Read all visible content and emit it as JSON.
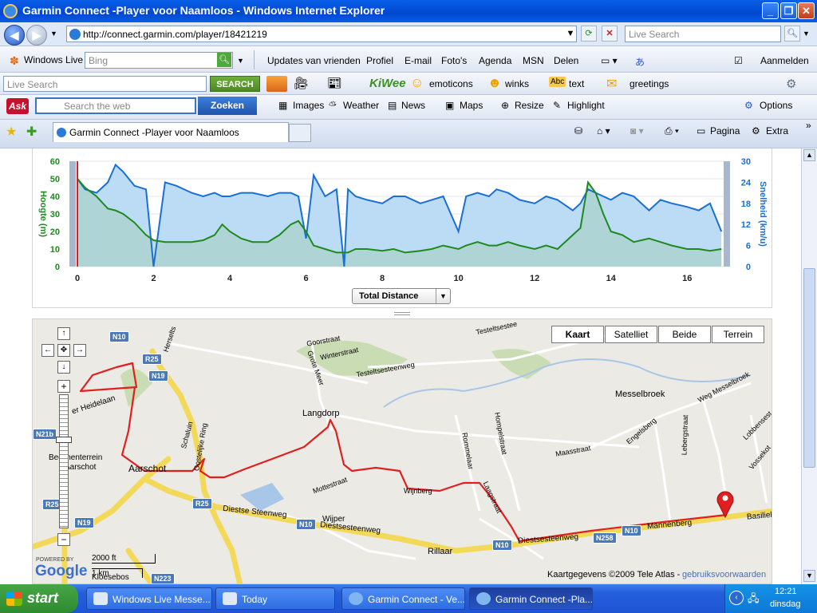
{
  "window": {
    "title": "Garmin Connect -Player voor Naamloos - Windows Internet Explorer"
  },
  "address": {
    "url": "http://connect.garmin.com/player/18421219",
    "search_placeholder": "Live Search"
  },
  "windows_live": {
    "label": "Windows Live",
    "bing_placeholder": "Bing",
    "links": [
      "Updates van vrienden",
      "Profiel",
      "E-mail",
      "Foto's",
      "Agenda",
      "MSN",
      "Delen"
    ],
    "signin": "Aanmelden"
  },
  "kiwee": {
    "search_placeholder": "Live Search",
    "search_button": "SEARCH",
    "brand": "KiWee",
    "items": [
      "emoticons",
      "winks",
      "text",
      "greetings"
    ]
  },
  "ask": {
    "logo": "Ask",
    "search_placeholder": "Search the web",
    "search_button": "Zoeken",
    "items": [
      "Images",
      "Weather",
      "News",
      "Maps",
      "Resize",
      "Highlight"
    ],
    "options": "Options"
  },
  "tabs": {
    "active": "Garmin Connect -Player voor Naamloos",
    "pagina": "Pagina",
    "extra": "Extra"
  },
  "chart": {
    "left_axis_label": "Hoogte (m)",
    "right_axis_label": "Snelheid (km/u)",
    "left_ticks": [
      "0",
      "10",
      "20",
      "30",
      "40",
      "50",
      "60"
    ],
    "right_ticks": [
      "0",
      "6",
      "12",
      "18",
      "24",
      "30"
    ],
    "x_ticks": [
      "0",
      "2",
      "4",
      "6",
      "8",
      "10",
      "12",
      "14",
      "16"
    ],
    "dropdown": "Total Distance"
  },
  "chart_data": {
    "type": "area",
    "x": [
      0,
      0.2,
      0.5,
      0.8,
      1.0,
      1.2,
      1.5,
      1.8,
      2.0,
      2.3,
      2.6,
      3.0,
      3.3,
      3.6,
      3.8,
      4.0,
      4.3,
      4.6,
      5.0,
      5.3,
      5.6,
      5.8,
      6.0,
      6.2,
      6.5,
      6.8,
      7.0,
      7.1,
      7.3,
      7.6,
      8.0,
      8.3,
      8.6,
      9.0,
      9.3,
      9.6,
      10.0,
      10.2,
      10.5,
      10.8,
      11.0,
      11.3,
      11.6,
      12.0,
      12.3,
      12.6,
      13.0,
      13.2,
      13.4,
      13.6,
      13.8,
      14.0,
      14.3,
      14.6,
      15.0,
      15.3,
      15.6,
      16.0,
      16.3,
      16.6,
      16.9
    ],
    "series": [
      {
        "name": "Hoogte (m)",
        "axis": "left",
        "values": [
          50,
          45,
          40,
          33,
          32,
          30,
          25,
          18,
          15,
          14,
          14,
          14,
          15,
          18,
          24,
          20,
          16,
          14,
          14,
          18,
          24,
          26,
          20,
          12,
          10,
          8,
          8,
          8,
          10,
          10,
          9,
          10,
          8,
          9,
          10,
          12,
          10,
          12,
          14,
          12,
          12,
          14,
          12,
          10,
          12,
          10,
          18,
          22,
          48,
          42,
          30,
          20,
          18,
          14,
          16,
          14,
          12,
          10,
          10,
          9,
          10
        ]
      },
      {
        "name": "Snelheid (km/u)",
        "axis": "right",
        "values": [
          25,
          22,
          21,
          24,
          29,
          27,
          23,
          22,
          0,
          24,
          23,
          21,
          20,
          21,
          20,
          20,
          21,
          21,
          20,
          21,
          21,
          20,
          8,
          26,
          20,
          22,
          0,
          22,
          20,
          19,
          18,
          20,
          20,
          18,
          19,
          20,
          10,
          20,
          21,
          20,
          22,
          21,
          19,
          18,
          20,
          19,
          16,
          18,
          22,
          21,
          20,
          19,
          21,
          20,
          16,
          19,
          18,
          17,
          16,
          18,
          10
        ]
      }
    ],
    "xlabel": "Total Distance",
    "ylabel": "Hoogte (m)",
    "y2label": "Snelheid (km/u)",
    "ylim": [
      0,
      60
    ],
    "y2lim": [
      0,
      30
    ],
    "xlim": [
      0,
      17
    ]
  },
  "map": {
    "types": [
      "Kaart",
      "Satelliet",
      "Beide",
      "Terrein"
    ],
    "active_type": "Kaart",
    "labels": {
      "langdorp": "Langdorp",
      "messelbroek": "Messelbroek",
      "aarschot": "Aarschot",
      "rillaar": "Rillaar",
      "wipper": "Wijper",
      "diestse": "Diestse Steenweg",
      "diestse2": "Diestsesteenweg",
      "diestse3": "Diestsesteenweg",
      "mannenberg": "Mannenberg",
      "basiliek": "Basiliekt",
      "kloesebos": "Kloesebos",
      "begijnen": "Begijnenterrein",
      "aarschot2": "Aarschot",
      "heidelaan": "er Heidelaan",
      "goorstraat": "Goorstraat",
      "winterstraat": "Winterstraat",
      "testelt": "Testeltsesteenweg",
      "testelt2": "Testeltsestee",
      "maasstraat": "Maasstraat",
      "engelsberg": "Engelsberg",
      "lebergstraat": "Lebergstraat",
      "wegmessel": "Weg Messelbroek",
      "rommelaar": "Rommelaar",
      "hompelstraat": "Hompelstraat",
      "mottestraat": "Mottestraat",
      "wijnberg": "Wijnberg",
      "laagstraat": "Laagstraat",
      "ostring": "Oostelijke Ring",
      "schaluin": "Schaluin",
      "herseltsesteenweg": "Herselts",
      "grote_meer": "Grote Meer",
      "lobbenses": "Lobbensest",
      "vossekot": "Vossekot"
    },
    "road_badges": [
      "N10",
      "R25",
      "N19",
      "R25",
      "N10",
      "N10",
      "N258",
      "N10",
      "N19",
      "N223",
      "R25",
      "N21b"
    ],
    "scale_ft": "2000 ft",
    "scale_km": "1 km",
    "powered_by": "POWERED BY",
    "google": "Google",
    "attribution": "Kaartgegevens ©2009 Tele Atlas -",
    "terms": "gebruiksvoorwaarden"
  },
  "taskbar": {
    "start": "start",
    "tasks": [
      "Windows Live Messe...",
      "Today",
      "Garmin Connect - Ve...",
      "Garmin Connect -Pla..."
    ],
    "time": "12:21",
    "day": "dinsdag"
  },
  "colors": {
    "elevation": "#1e8a1e",
    "speed": "#1a6fd4",
    "route": "#e02020",
    "road_major": "#f7e36a"
  }
}
